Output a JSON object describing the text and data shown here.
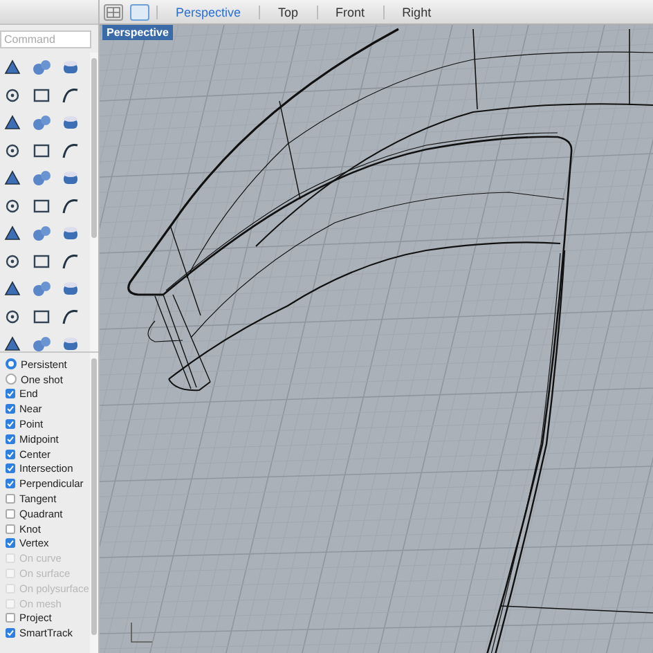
{
  "command": {
    "placeholder": "Command"
  },
  "viewport_tabs": [
    {
      "label": "Perspective",
      "selected": true
    },
    {
      "label": "Top",
      "selected": false
    },
    {
      "label": "Front",
      "selected": false
    },
    {
      "label": "Right",
      "selected": false
    }
  ],
  "viewport": {
    "label": "Perspective"
  },
  "osnap": [
    {
      "kind": "radio",
      "label": "Persistent",
      "selected": true
    },
    {
      "kind": "radio",
      "label": "One shot",
      "selected": false
    },
    {
      "kind": "checkbox",
      "label": "End",
      "checked": true,
      "disabled": false
    },
    {
      "kind": "checkbox",
      "label": "Near",
      "checked": true,
      "disabled": false
    },
    {
      "kind": "checkbox",
      "label": "Point",
      "checked": true,
      "disabled": false
    },
    {
      "kind": "checkbox",
      "label": "Midpoint",
      "checked": true,
      "disabled": false
    },
    {
      "kind": "checkbox",
      "label": "Center",
      "checked": true,
      "disabled": false
    },
    {
      "kind": "checkbox",
      "label": "Intersection",
      "checked": true,
      "disabled": false
    },
    {
      "kind": "checkbox",
      "label": "Perpendicular",
      "checked": true,
      "disabled": false
    },
    {
      "kind": "checkbox",
      "label": "Tangent",
      "checked": false,
      "disabled": false
    },
    {
      "kind": "checkbox",
      "label": "Quadrant",
      "checked": false,
      "disabled": false
    },
    {
      "kind": "checkbox",
      "label": "Knot",
      "checked": false,
      "disabled": false
    },
    {
      "kind": "checkbox",
      "label": "Vertex",
      "checked": true,
      "disabled": false
    },
    {
      "kind": "checkbox",
      "label": "On curve",
      "checked": false,
      "disabled": true
    },
    {
      "kind": "checkbox",
      "label": "On surface",
      "checked": false,
      "disabled": true
    },
    {
      "kind": "checkbox",
      "label": "On polysurface",
      "checked": false,
      "disabled": true
    },
    {
      "kind": "checkbox",
      "label": "On mesh",
      "checked": false,
      "disabled": true
    },
    {
      "kind": "checkbox",
      "label": "Project",
      "checked": false,
      "disabled": false
    },
    {
      "kind": "checkbox",
      "label": "SmartTrack",
      "checked": true,
      "disabled": false
    }
  ]
}
